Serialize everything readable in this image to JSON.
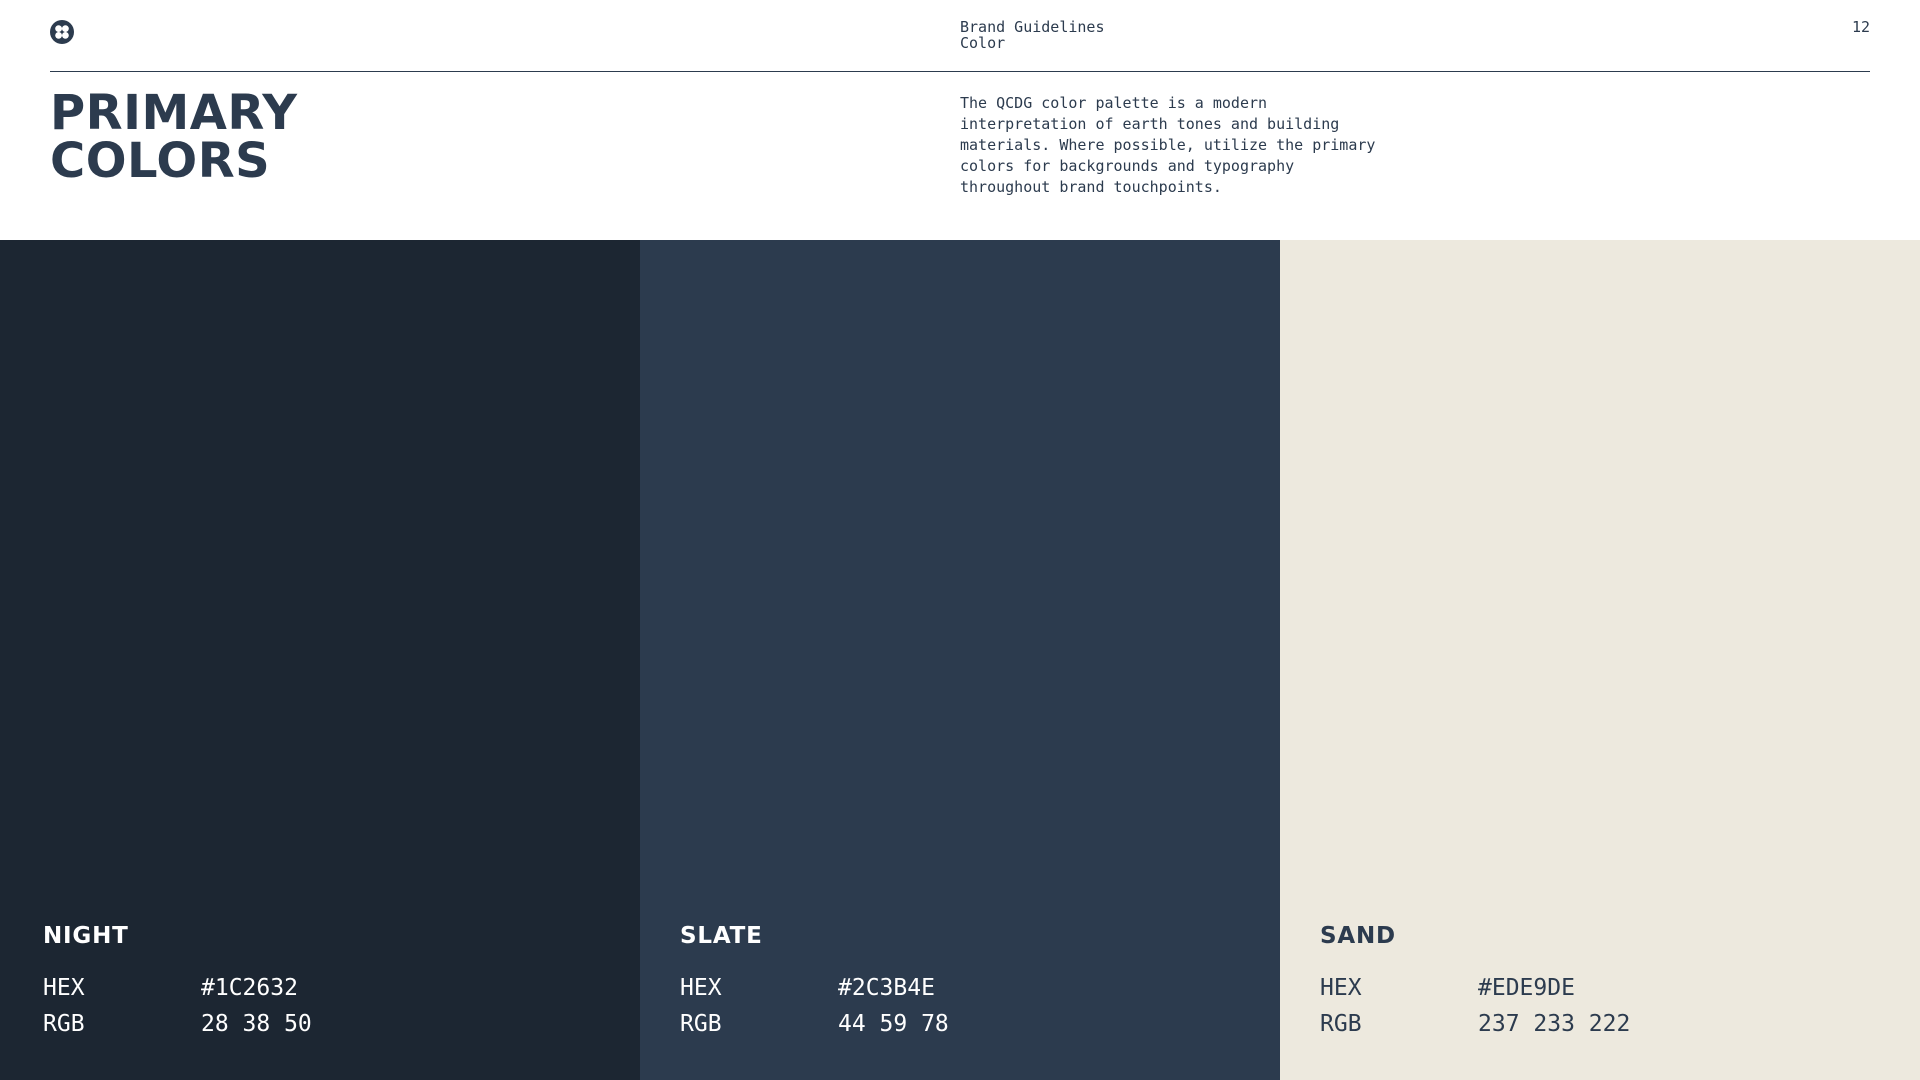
{
  "header": {
    "doc_title": "Brand Guidelines",
    "section": "Color",
    "page_number": "12",
    "logo_icon": "four-circle-logo-icon"
  },
  "title": {
    "line1": "PRIMARY",
    "line2": "COLORS"
  },
  "intro": "The QCDG color palette is a modern\ninterpretation of earth tones and building\nmaterials. Where possible, utilize the primary\ncolors for backgrounds and typography\nthroughout brand touchpoints.",
  "colors": {
    "text_dark": "#2C3B4E",
    "text_light": "#FFFFFF"
  },
  "swatches": [
    {
      "name": "NIGHT",
      "hex_label": "HEX",
      "hex": "#1C2632",
      "rgb_label": "RGB",
      "rgb": "28 38 50",
      "text_color": "#FFFFFF"
    },
    {
      "name": "SLATE",
      "hex_label": "HEX",
      "hex": "#2C3B4E",
      "rgb_label": "RGB",
      "rgb": "44 59 78",
      "text_color": "#FFFFFF"
    },
    {
      "name": "SAND",
      "hex_label": "HEX",
      "hex": "#EDE9DE",
      "rgb_label": "RGB",
      "rgb": "237 233 222",
      "text_color": "#2C3B4E"
    }
  ]
}
